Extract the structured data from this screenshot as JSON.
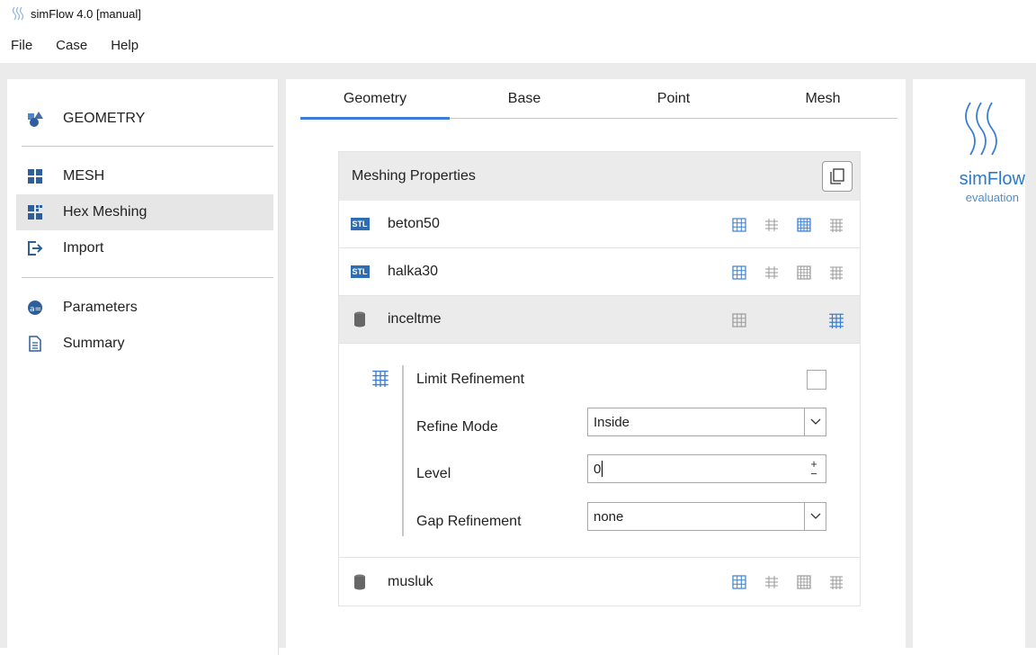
{
  "window": {
    "title": "simFlow 4.0 [manual]"
  },
  "menu": {
    "items": [
      "File",
      "Case",
      "Help"
    ]
  },
  "sidebar": {
    "items": [
      {
        "label": "GEOMETRY",
        "icon": "shapes-icon"
      },
      {
        "label": "MESH",
        "icon": "grid-icon"
      },
      {
        "label": "Hex Meshing",
        "icon": "hex-mesh-icon",
        "selected": true
      },
      {
        "label": "Import",
        "icon": "import-icon"
      },
      {
        "label": "Parameters",
        "icon": "parameters-icon"
      },
      {
        "label": "Summary",
        "icon": "document-icon"
      }
    ]
  },
  "tabs": [
    {
      "label": "Geometry",
      "active": true
    },
    {
      "label": "Base"
    },
    {
      "label": "Point"
    },
    {
      "label": "Mesh"
    }
  ],
  "panel": {
    "title": "Meshing Properties",
    "stl_badge": "STL",
    "rows": [
      {
        "name": "beton50",
        "type": "stl"
      },
      {
        "name": "halka30",
        "type": "stl"
      },
      {
        "name": "inceltme",
        "type": "cylinder",
        "selected": true
      },
      {
        "name": "musluk",
        "type": "cylinder"
      }
    ],
    "detail": {
      "limit_refinement_label": "Limit Refinement",
      "refine_mode_label": "Refine Mode",
      "refine_mode_value": "Inside",
      "level_label": "Level",
      "level_value": "0",
      "gap_refinement_label": "Gap Refinement",
      "gap_refinement_value": "none"
    }
  },
  "brand": {
    "name": "simFlow",
    "subtitle": "evaluation"
  },
  "colors": {
    "accent": "#3b7fd4",
    "brand": "#2e79c5",
    "stl": "#2e6db4"
  }
}
